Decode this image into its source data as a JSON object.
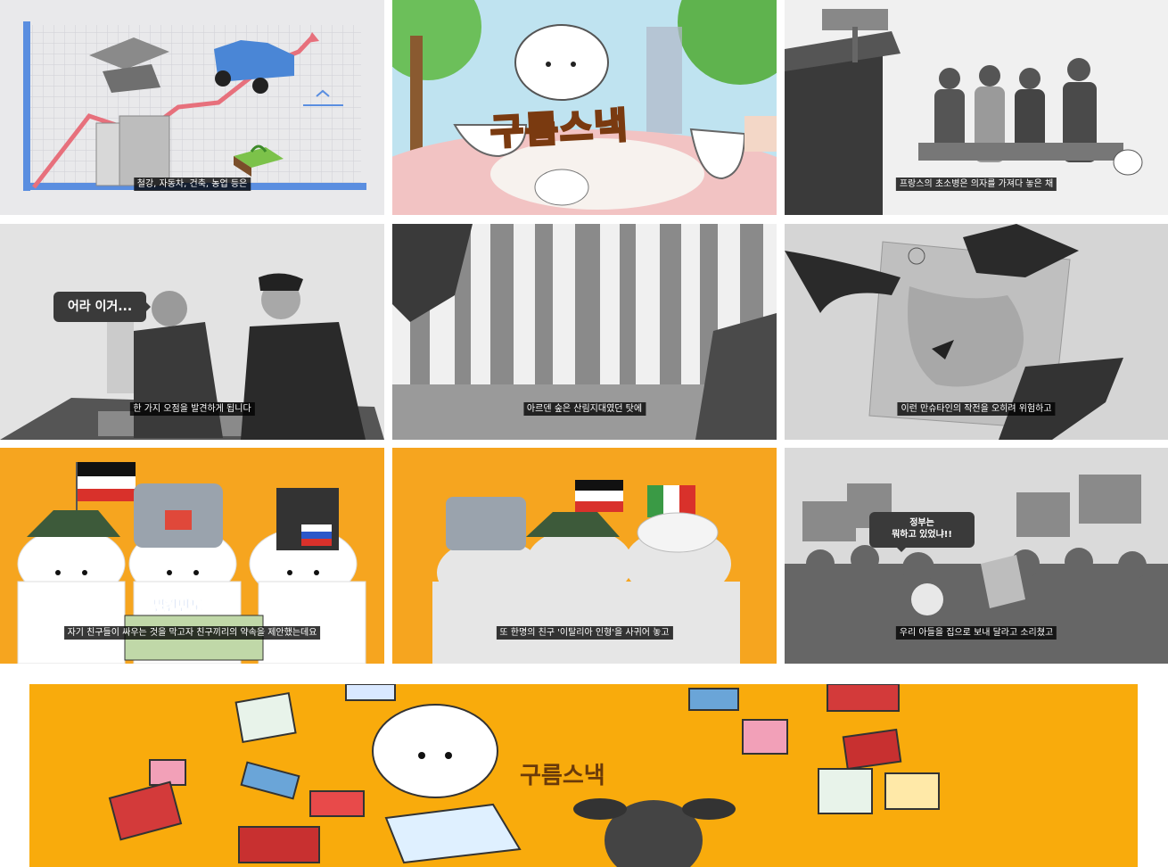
{
  "panels": [
    {
      "id": "p1",
      "caption": "철강, 자동차, 건축, 농업 등은"
    },
    {
      "id": "p2",
      "logo": "구름스낵"
    },
    {
      "id": "p3",
      "caption": "프랑스의 초소병은 의자를 가져다 놓은 채"
    },
    {
      "id": "p4",
      "caption": "한 가지 오점을 발견하게 됩니다",
      "bubble": "어라 이거..."
    },
    {
      "id": "p5",
      "caption": "아르덴 숲은 산림지대였던 탓에"
    },
    {
      "id": "p6",
      "caption": "이런 만슈타인의 작전을 오히려 위험하고"
    },
    {
      "id": "p7",
      "caption": "자기 친구들이 싸우는 것을 막고자 친구끼리의 약속을 제안했는데요",
      "tag": "발칸반도"
    },
    {
      "id": "p8",
      "caption": "또 한명의 친구 '이탈리아 인형'을 사귀어 놓고"
    },
    {
      "id": "p9",
      "caption": "우리 아들을 집으로 보내 달라고 소리쳤고",
      "bubble_line1": "정부는",
      "bubble_line2": "뭐하고 있었냐!!"
    }
  ],
  "banner": {
    "logo": "구름스낵"
  },
  "colors": {
    "accent_orange": "#f5a623",
    "banner_yellow": "#f9ab0c",
    "subtitle_bg": "#1a1a1a"
  }
}
